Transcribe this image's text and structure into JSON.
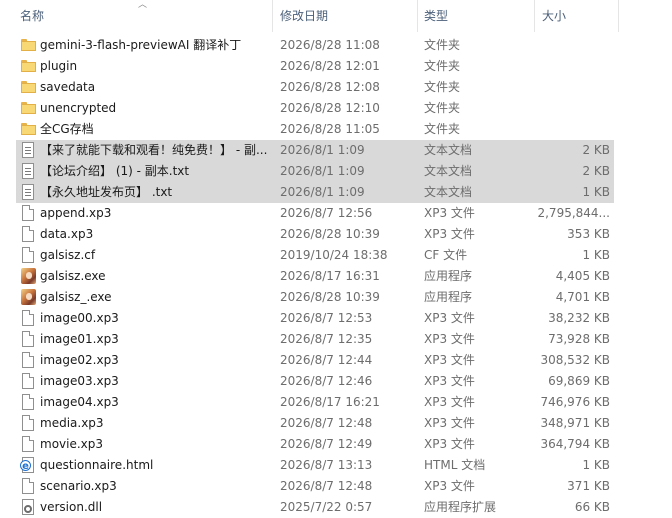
{
  "columns": {
    "name": "名称",
    "date": "修改日期",
    "type": "类型",
    "size": "大小"
  },
  "files": [
    {
      "name": "gemini-3-flash-previewAI 翻译补丁",
      "date": "2026/8/28 11:08",
      "type": "文件夹",
      "size": "",
      "icon": "folder-icon",
      "selected": false
    },
    {
      "name": "plugin",
      "date": "2026/8/28 12:01",
      "type": "文件夹",
      "size": "",
      "icon": "folder-icon",
      "selected": false
    },
    {
      "name": "savedata",
      "date": "2026/8/28 12:08",
      "type": "文件夹",
      "size": "",
      "icon": "folder-icon",
      "selected": false
    },
    {
      "name": "unencrypted",
      "date": "2026/8/28 12:10",
      "type": "文件夹",
      "size": "",
      "icon": "folder-icon",
      "selected": false
    },
    {
      "name": "全CG存档",
      "date": "2026/8/28 11:05",
      "type": "文件夹",
      "size": "",
      "icon": "folder-icon",
      "selected": false
    },
    {
      "name": "【来了就能下载和观看！纯免费！】 - 副...",
      "date": "2026/8/1 1:09",
      "type": "文本文档",
      "size": "2 KB",
      "icon": "text-document-icon",
      "selected": true
    },
    {
      "name": "【论坛介绍】 (1) - 副本.txt",
      "date": "2026/8/1 1:09",
      "type": "文本文档",
      "size": "2 KB",
      "icon": "text-document-icon",
      "selected": true
    },
    {
      "name": "【永久地址发布页】 .txt",
      "date": "2026/8/1 1:09",
      "type": "文本文档",
      "size": "1 KB",
      "icon": "text-document-icon",
      "selected": true
    },
    {
      "name": "append.xp3",
      "date": "2026/8/7 12:56",
      "type": "XP3 文件",
      "size": "2,795,844...",
      "icon": "file-icon",
      "selected": false
    },
    {
      "name": "data.xp3",
      "date": "2026/8/28 10:39",
      "type": "XP3 文件",
      "size": "353 KB",
      "icon": "file-icon",
      "selected": false
    },
    {
      "name": "galsisz.cf",
      "date": "2019/10/24 18:38",
      "type": "CF 文件",
      "size": "1 KB",
      "icon": "file-icon",
      "selected": false
    },
    {
      "name": "galsisz.exe",
      "date": "2026/8/17 16:31",
      "type": "应用程序",
      "size": "4,405 KB",
      "icon": "application-icon",
      "selected": false
    },
    {
      "name": "galsisz_.exe",
      "date": "2026/8/28 10:39",
      "type": "应用程序",
      "size": "4,701 KB",
      "icon": "application-icon",
      "selected": false
    },
    {
      "name": "image00.xp3",
      "date": "2026/8/7 12:53",
      "type": "XP3 文件",
      "size": "38,232 KB",
      "icon": "file-icon",
      "selected": false
    },
    {
      "name": "image01.xp3",
      "date": "2026/8/7 12:35",
      "type": "XP3 文件",
      "size": "73,928 KB",
      "icon": "file-icon",
      "selected": false
    },
    {
      "name": "image02.xp3",
      "date": "2026/8/7 12:44",
      "type": "XP3 文件",
      "size": "308,532 KB",
      "icon": "file-icon",
      "selected": false
    },
    {
      "name": "image03.xp3",
      "date": "2026/8/7 12:46",
      "type": "XP3 文件",
      "size": "69,869 KB",
      "icon": "file-icon",
      "selected": false
    },
    {
      "name": "image04.xp3",
      "date": "2026/8/17 16:21",
      "type": "XP3 文件",
      "size": "746,976 KB",
      "icon": "file-icon",
      "selected": false
    },
    {
      "name": "media.xp3",
      "date": "2026/8/7 12:48",
      "type": "XP3 文件",
      "size": "348,971 KB",
      "icon": "file-icon",
      "selected": false
    },
    {
      "name": "movie.xp3",
      "date": "2026/8/7 12:49",
      "type": "XP3 文件",
      "size": "364,794 KB",
      "icon": "file-icon",
      "selected": false
    },
    {
      "name": "questionnaire.html",
      "date": "2026/8/7 13:13",
      "type": "HTML 文档",
      "size": "1 KB",
      "icon": "html-document-icon",
      "selected": false
    },
    {
      "name": "scenario.xp3",
      "date": "2026/8/7 12:48",
      "type": "XP3 文件",
      "size": "371 KB",
      "icon": "file-icon",
      "selected": false
    },
    {
      "name": "version.dll",
      "date": "2025/7/22 0:57",
      "type": "应用程序扩展",
      "size": "66 KB",
      "icon": "dll-file-icon",
      "selected": false
    }
  ],
  "colors": {
    "header_text": "#4c607a",
    "selection": "#d9d9d9",
    "folder": "#f8d775",
    "secondary_text": "#6d6d6d"
  }
}
